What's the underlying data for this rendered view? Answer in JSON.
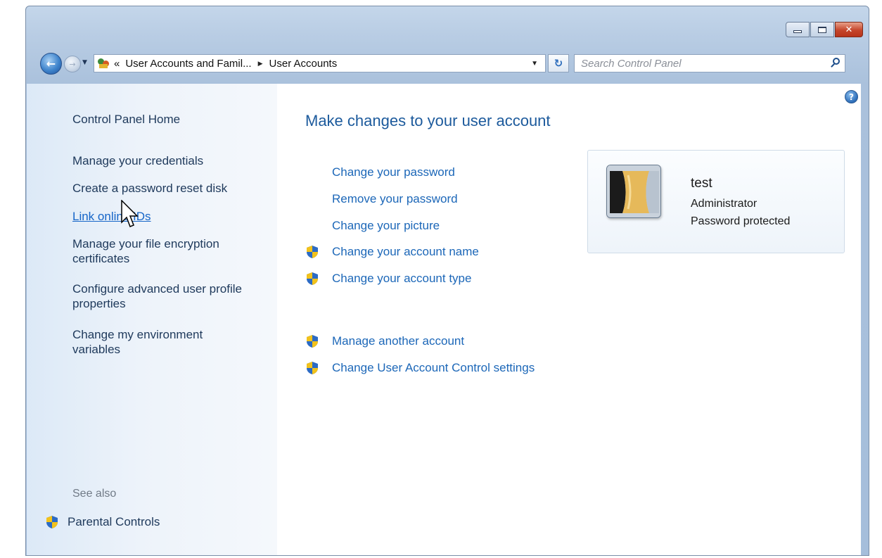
{
  "window": {
    "caption": {
      "minimize_icon": "minimize-icon",
      "maximize_icon": "maximize-icon",
      "close_icon": "close-icon",
      "close_glyph": "✕"
    }
  },
  "navbar": {
    "back_glyph": "←",
    "forward_glyph": "→",
    "recent_glyph": "▼",
    "address": {
      "overflow": "«",
      "segments": [
        "User Accounts and Famil...",
        "User Accounts"
      ],
      "separator": "▶",
      "dropdown": "▼"
    },
    "refresh_glyph": "↻",
    "search_placeholder": "Search Control Panel"
  },
  "sidebar": {
    "home": "Control Panel Home",
    "links": [
      "Manage your credentials",
      "Create a password reset disk",
      "Link online IDs",
      "Manage your file encryption certificates",
      "Configure advanced user profile properties",
      "Change my environment variables"
    ],
    "see_also_label": "See also",
    "see_also_links": [
      "Parental Controls"
    ]
  },
  "main": {
    "help_glyph": "?",
    "title": "Make changes to your user account",
    "tasks": [
      {
        "label": "Change your password",
        "shield": false
      },
      {
        "label": "Remove your password",
        "shield": false
      },
      {
        "label": "Change your picture",
        "shield": false
      },
      {
        "label": "Change your account name",
        "shield": true
      },
      {
        "label": "Change your account type",
        "shield": true
      }
    ],
    "other_tasks": [
      {
        "label": "Manage another account",
        "shield": true
      },
      {
        "label": "Change User Account Control settings",
        "shield": true
      }
    ]
  },
  "user": {
    "name": "test",
    "role": "Administrator",
    "status": "Password protected"
  },
  "colors": {
    "link": "#1c67b8",
    "title": "#1c5a9c",
    "sidebar_text": "#1e395b",
    "shield_blue": "#2c6bc5",
    "shield_yellow": "#f2c21b"
  }
}
